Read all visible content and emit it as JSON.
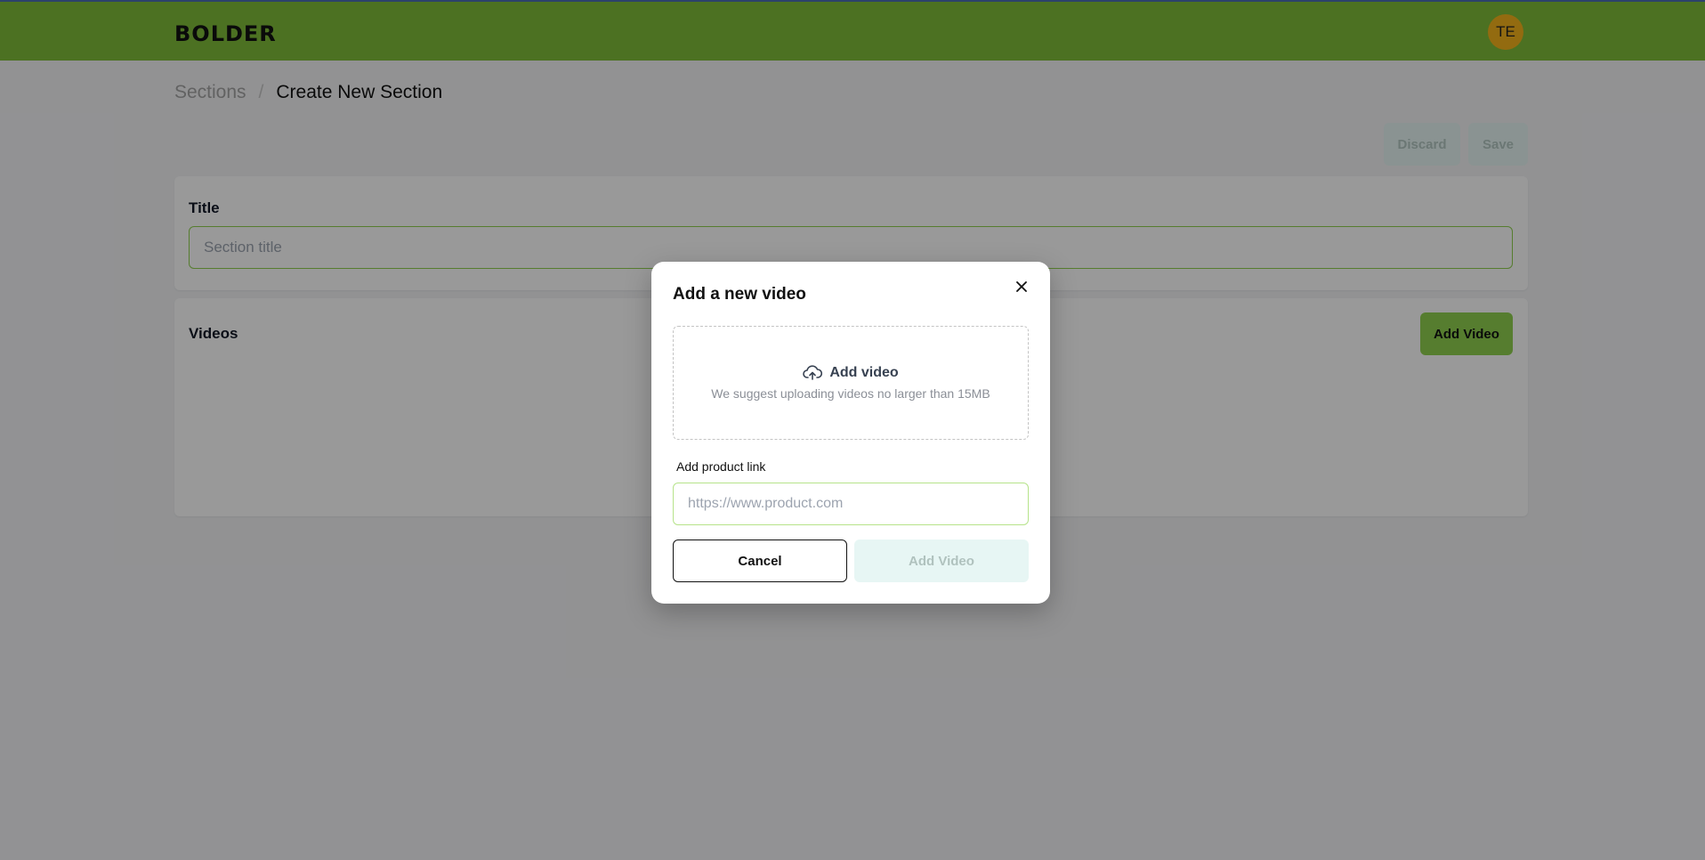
{
  "header": {
    "logo_text": "BOLDER",
    "avatar_initials": "TE",
    "bar_color": "#7fbd3a"
  },
  "breadcrumb": {
    "root": "Sections",
    "separator": "/",
    "current": "Create New Section"
  },
  "actions": {
    "discard_label": "Discard",
    "save_label": "Save"
  },
  "title_card": {
    "label": "Title",
    "input_placeholder": "Section title",
    "input_value": ""
  },
  "videos_card": {
    "label": "Videos",
    "add_button_label": "Add Video"
  },
  "modal": {
    "title": "Add a new video",
    "close_icon": "close-icon",
    "dropzone": {
      "icon": "cloud-upload-icon",
      "heading": "Add video",
      "hint": "We suggest uploading videos no larger than 15MB"
    },
    "product_link": {
      "label": "Add product link",
      "placeholder": "https://www.product.com",
      "value": ""
    },
    "cancel_label": "Cancel",
    "submit_label": "Add Video"
  },
  "colors": {
    "accent_green": "#8fd14f",
    "disabled_button_bg": "#e7f6f4",
    "avatar_bg": "#f6b21b"
  }
}
